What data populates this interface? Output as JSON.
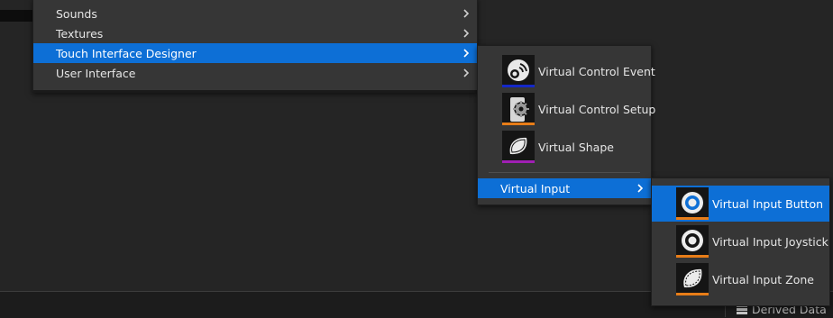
{
  "menu_categories": [
    {
      "label": "Sounds"
    },
    {
      "label": "Textures"
    },
    {
      "label": "Touch Interface Designer"
    },
    {
      "label": "User Interface"
    }
  ],
  "submenu_touch": {
    "items": [
      {
        "label": "Virtual Control Event",
        "icon": "virtual-control-event-icon",
        "accent": "#1428c8"
      },
      {
        "label": "Virtual Control Setup",
        "icon": "virtual-control-setup-icon",
        "accent": "#e87d18"
      },
      {
        "label": "Virtual Shape",
        "icon": "virtual-shape-icon",
        "accent": "#a020b4"
      }
    ],
    "group_label": "Virtual Input"
  },
  "submenu_virtual_input": {
    "items": [
      {
        "label": "Virtual Input Button",
        "icon": "virtual-input-button-icon",
        "accent": "#e87d18"
      },
      {
        "label": "Virtual Input Joystick",
        "icon": "virtual-input-joystick-icon",
        "accent": "#e87d18"
      },
      {
        "label": "Virtual Input Zone",
        "icon": "virtual-input-zone-icon",
        "accent": "#e87d18"
      }
    ]
  },
  "status_bar": {
    "derived_data_label": "Derived Data"
  },
  "colors": {
    "selection": "#0d6fd6",
    "menu_bg": "#363636",
    "page_bg": "#252525"
  }
}
